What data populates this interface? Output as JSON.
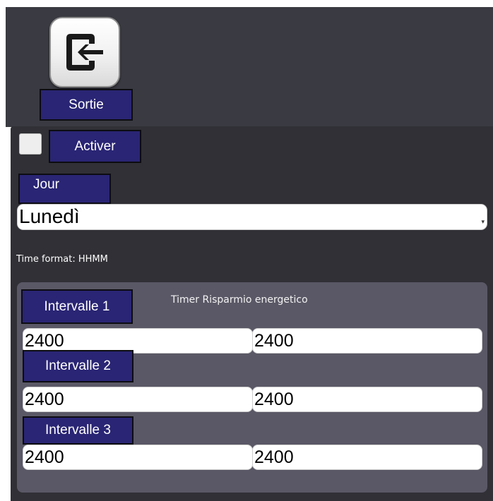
{
  "header": {
    "exit_icon": "exit-arrow-icon",
    "exit_label": "Sortie"
  },
  "enable": {
    "checked": false,
    "label": "Activer"
  },
  "day": {
    "label": "Jour",
    "selected": "Lunedì"
  },
  "time_format_text": "Time format: HHMM",
  "timer": {
    "title": "Timer Risparmio energetico",
    "intervals": [
      {
        "label": "Intervalle 1",
        "start": "2400",
        "end": "2400"
      },
      {
        "label": "Intervalle 2",
        "start": "2400",
        "end": "2400"
      },
      {
        "label": "Intervalle 3",
        "start": "2400",
        "end": "2400"
      }
    ]
  },
  "colors": {
    "label_bg": "#2a2574",
    "panel_bg": "#303036",
    "timer_panel_bg": "#5a5866"
  }
}
